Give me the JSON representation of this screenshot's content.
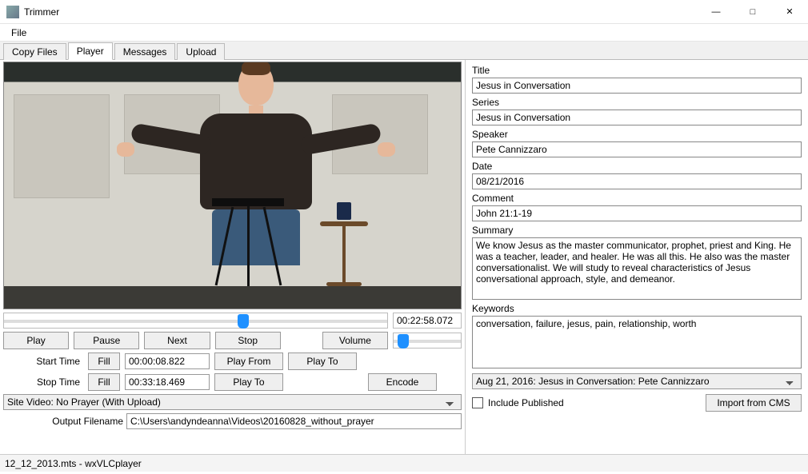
{
  "window": {
    "title": "Trimmer"
  },
  "menu": {
    "file": "File"
  },
  "tabs": {
    "copy_files": "Copy Files",
    "player": "Player",
    "messages": "Messages",
    "upload": "Upload",
    "active": "player"
  },
  "player": {
    "seek_time": "00:22:58.072",
    "seek_position_pct": 61,
    "buttons": {
      "play": "Play",
      "pause": "Pause",
      "next": "Next",
      "stop": "Stop",
      "volume": "Volume"
    },
    "volume_pct": 6,
    "start": {
      "label": "Start Time",
      "fill": "Fill",
      "value": "00:00:08.822",
      "play_from": "Play From",
      "play_to": "Play To"
    },
    "stop_row": {
      "label": "Stop Time",
      "fill": "Fill",
      "value": "00:33:18.469",
      "play_to": "Play To",
      "encode": "Encode"
    },
    "site_video_select": "Site Video: No Prayer (With Upload)",
    "output_label": "Output Filename",
    "output_value": "C:\\Users\\andyndeanna\\Videos\\20160828_without_prayer"
  },
  "meta": {
    "title_label": "Title",
    "title": "Jesus in Conversation",
    "series_label": "Series",
    "series": "Jesus in Conversation",
    "speaker_label": "Speaker",
    "speaker": "Pete Cannizzaro",
    "date_label": "Date",
    "date": "08/21/2016",
    "comment_label": "Comment",
    "comment": "John 21:1-19",
    "summary_label": "Summary",
    "summary": "We know Jesus as the master communicator, prophet, priest and King. He was a teacher, leader, and healer. He was all this. He also was the master conversationalist. We will study to reveal characteristics of Jesus conversational approach, style, and demeanor.",
    "keywords_label": "Keywords",
    "keywords": "conversation, failure, jesus, pain, relationship, worth",
    "history_select": "Aug 21, 2016: Jesus in Conversation: Pete Cannizzaro",
    "include_published": "Include Published",
    "import_cms": "Import from CMS"
  },
  "status": "12_12_2013.mts - wxVLCplayer"
}
